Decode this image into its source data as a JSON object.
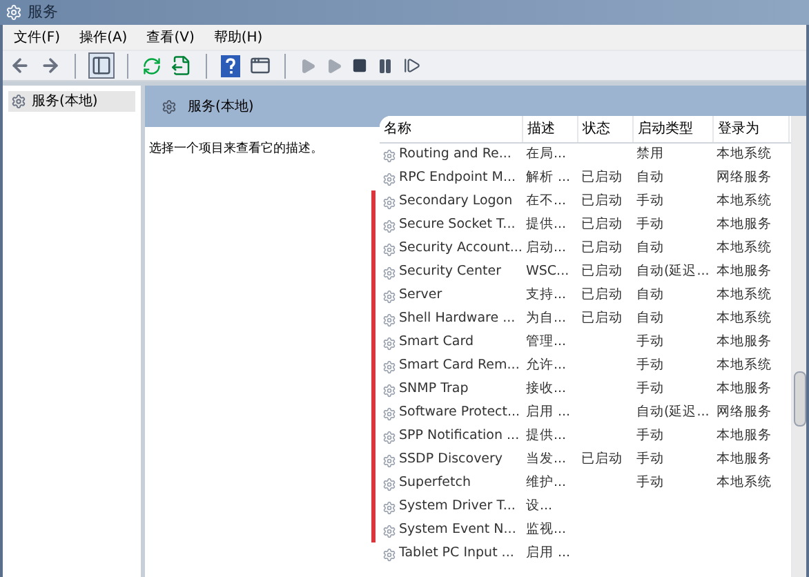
{
  "window": {
    "title": "服务"
  },
  "menu": [
    "文件(F)",
    "操作(A)",
    "查看(V)",
    "帮助(H)"
  ],
  "toolbar": [
    {
      "kind": "back",
      "disabled": false
    },
    {
      "kind": "forward",
      "disabled": false
    },
    {
      "kind": "sep"
    },
    {
      "kind": "tree",
      "disabled": false
    },
    {
      "kind": "sep"
    },
    {
      "kind": "refresh",
      "disabled": false
    },
    {
      "kind": "export",
      "disabled": false
    },
    {
      "kind": "sep"
    },
    {
      "kind": "help",
      "disabled": false
    },
    {
      "kind": "props",
      "disabled": false
    },
    {
      "kind": "sep"
    },
    {
      "kind": "start",
      "disabled": true
    },
    {
      "kind": "start",
      "disabled": true
    },
    {
      "kind": "stop",
      "disabled": false
    },
    {
      "kind": "pause",
      "disabled": false
    },
    {
      "kind": "resume",
      "disabled": false
    }
  ],
  "tree": {
    "items": [
      {
        "label": "服务(本地)",
        "selected": true
      }
    ]
  },
  "panel": {
    "title": "服务(本地)",
    "description": "选择一个项目来查看它的描述。"
  },
  "table": {
    "columns": [
      "名称",
      "描述",
      "状态",
      "启动类型",
      "登录为"
    ],
    "rows": [
      {
        "cells": [
          "Routing and Re...",
          "在局...",
          "",
          "禁用",
          "本地系统"
        ],
        "marked": false
      },
      {
        "cells": [
          "RPC Endpoint M...",
          "解析 ...",
          "已启动",
          "自动",
          "网络服务"
        ],
        "marked": false
      },
      {
        "cells": [
          "Secondary Logon",
          "在不...",
          "已启动",
          "手动",
          "本地系统"
        ],
        "marked": true
      },
      {
        "cells": [
          "Secure Socket T...",
          "提供...",
          "已启动",
          "手动",
          "本地服务"
        ],
        "marked": true
      },
      {
        "cells": [
          "Security Account...",
          "启动...",
          "已启动",
          "自动",
          "本地系统"
        ],
        "marked": true
      },
      {
        "cells": [
          "Security Center",
          "WSC...",
          "已启动",
          "自动(延迟...",
          "本地服务"
        ],
        "marked": true
      },
      {
        "cells": [
          "Server",
          "支持...",
          "已启动",
          "自动",
          "本地系统"
        ],
        "marked": true
      },
      {
        "cells": [
          "Shell Hardware ...",
          "为自...",
          "已启动",
          "自动",
          "本地系统"
        ],
        "marked": true
      },
      {
        "cells": [
          "Smart Card",
          "管理...",
          "",
          "手动",
          "本地服务"
        ],
        "marked": true
      },
      {
        "cells": [
          "Smart Card Rem...",
          "允许...",
          "",
          "手动",
          "本地系统"
        ],
        "marked": true
      },
      {
        "cells": [
          "SNMP Trap",
          "接收...",
          "",
          "手动",
          "本地服务"
        ],
        "marked": true
      },
      {
        "cells": [
          "Software Protect...",
          "启用 ...",
          "",
          "自动(延迟...",
          "网络服务"
        ],
        "marked": true
      },
      {
        "cells": [
          "SPP Notification ...",
          "提供...",
          "",
          "手动",
          "本地服务"
        ],
        "marked": true
      },
      {
        "cells": [
          "SSDP Discovery",
          "当发...",
          "已启动",
          "手动",
          "本地服务"
        ],
        "marked": true
      },
      {
        "cells": [
          "Superfetch",
          "维护...",
          "",
          "手动",
          "本地系统"
        ],
        "marked": true
      },
      {
        "cells": [
          "System Driver T...",
          "设...",
          "",
          "",
          ""
        ],
        "marked": true
      },
      {
        "cells": [
          "System Event N...",
          "监视...",
          "",
          "",
          ""
        ],
        "marked": true
      },
      {
        "cells": [
          "Tablet PC Input ...",
          "启用 ...",
          "",
          "",
          ""
        ],
        "marked": false
      }
    ]
  }
}
